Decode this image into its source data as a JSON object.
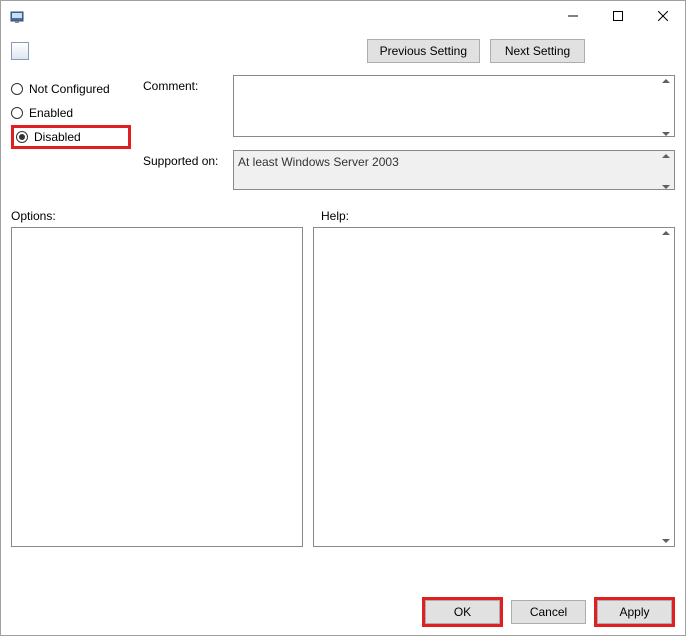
{
  "titlebar": {
    "title": ""
  },
  "nav": {
    "prev_label": "Previous Setting",
    "next_label": "Next Setting"
  },
  "radios": {
    "not_configured_label": "Not Configured",
    "enabled_label": "Enabled",
    "disabled_label": "Disabled",
    "selected": "disabled"
  },
  "fields": {
    "comment_label": "Comment:",
    "comment_value": "",
    "supported_label": "Supported on:",
    "supported_value": "At least Windows Server 2003"
  },
  "panels": {
    "options_label": "Options:",
    "help_label": "Help:"
  },
  "footer": {
    "ok_label": "OK",
    "cancel_label": "Cancel",
    "apply_label": "Apply"
  }
}
